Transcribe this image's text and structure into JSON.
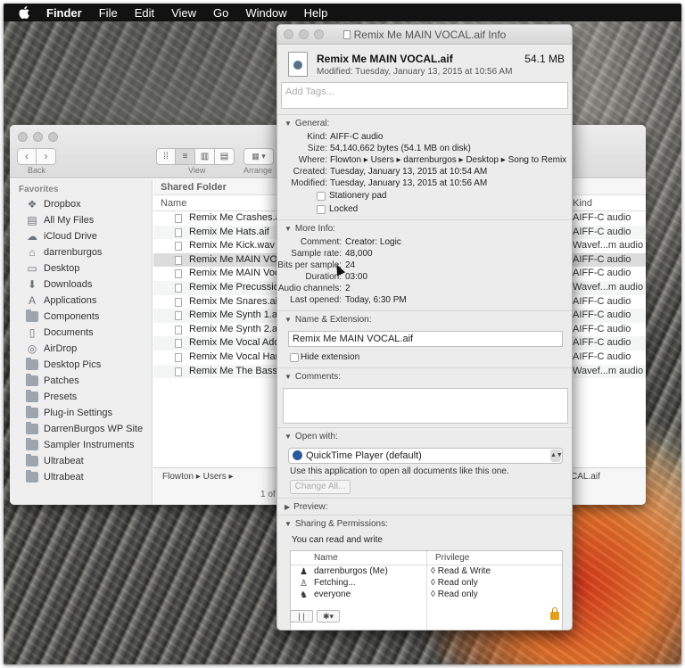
{
  "menubar": {
    "items": [
      "Finder",
      "File",
      "Edit",
      "View",
      "Go",
      "Window",
      "Help"
    ]
  },
  "finder": {
    "toolbar": {
      "back_label": "Back",
      "view_label": "View",
      "arrange_label": "Arrange"
    },
    "sidebar": {
      "header": "Favorites",
      "items": [
        {
          "label": "Dropbox",
          "icon": "dropbox-icon"
        },
        {
          "label": "All My Files",
          "icon": "all-files-icon"
        },
        {
          "label": "iCloud Drive",
          "icon": "cloud-icon"
        },
        {
          "label": "darrenburgos",
          "icon": "home-icon"
        },
        {
          "label": "Desktop",
          "icon": "desktop-icon"
        },
        {
          "label": "Downloads",
          "icon": "downloads-icon"
        },
        {
          "label": "Applications",
          "icon": "applications-icon"
        },
        {
          "label": "Components",
          "icon": "folder-icon"
        },
        {
          "label": "Documents",
          "icon": "documents-icon"
        },
        {
          "label": "AirDrop",
          "icon": "airdrop-icon"
        },
        {
          "label": "Desktop Pics",
          "icon": "folder-icon"
        },
        {
          "label": "Patches",
          "icon": "folder-icon"
        },
        {
          "label": "Presets",
          "icon": "folder-icon"
        },
        {
          "label": "Plug-in Settings",
          "icon": "folder-icon"
        },
        {
          "label": "DarrenBurgos WP Site",
          "icon": "folder-icon"
        },
        {
          "label": "Sampler Instruments",
          "icon": "folder-icon"
        },
        {
          "label": "Ultrabeat",
          "icon": "folder-icon"
        },
        {
          "label": "Ultrabeat",
          "icon": "folder-icon"
        }
      ]
    },
    "list": {
      "shared_header": "Shared Folder",
      "col_name": "Name",
      "col_kind": "Kind",
      "rows": [
        {
          "name": "Remix Me Crashes.aif",
          "kind": "AIFF-C audio"
        },
        {
          "name": "Remix Me Hats.aif",
          "kind": "AIFF-C audio"
        },
        {
          "name": "Remix Me Kick.wav",
          "kind": "Wavef...m audio"
        },
        {
          "name": "Remix Me MAIN VOCA",
          "kind": "AIFF-C audio"
        },
        {
          "name": "Remix Me MAIN Vocal",
          "kind": "AIFF-C audio"
        },
        {
          "name": "Remix Me Precussion",
          "kind": "Wavef...m audio"
        },
        {
          "name": "Remix Me Snares.aif",
          "kind": "AIFF-C audio"
        },
        {
          "name": "Remix Me Synth 1.aif",
          "kind": "AIFF-C audio"
        },
        {
          "name": "Remix Me Synth 2.aif",
          "kind": "AIFF-C audio"
        },
        {
          "name": "Remix Me Vocal Add L",
          "kind": "AIFF-C audio"
        },
        {
          "name": "Remix Me Vocal Harm",
          "kind": "AIFF-C audio"
        },
        {
          "name": "Remix Me The Bass",
          "kind": "Wavef...m audio"
        }
      ]
    },
    "pathbar": {
      "left": "Flowton ▸ Users ▸",
      "right": "CAL.aif"
    },
    "status": "1 of"
  },
  "info": {
    "title": "Remix Me MAIN VOCAL.aif Info",
    "filename": "Remix Me MAIN VOCAL.aif",
    "size": "54.1 MB",
    "modified": "Modified: Tuesday, January 13, 2015 at 10:56 AM",
    "tags_placeholder": "Add Tags...",
    "general": {
      "title": "General:",
      "kind_k": "Kind:",
      "kind_v": "AIFF-C audio",
      "size_k": "Size:",
      "size_v": "54,140,662 bytes (54.1 MB on disk)",
      "where_k": "Where:",
      "where_v": "Flowton ▸ Users ▸ darrenburgos ▸ Desktop ▸ Song to Remix",
      "created_k": "Created:",
      "created_v": "Tuesday, January 13, 2015 at 10:54 AM",
      "modified_k": "Modified:",
      "modified_v": "Tuesday, January 13, 2015 at 10:56 AM",
      "stationery": "Stationery pad",
      "locked": "Locked"
    },
    "more": {
      "title": "More Info:",
      "comment_k": "Comment:",
      "comment_v": "Creator: Logic",
      "rate_k": "Sample rate:",
      "rate_v": "48,000",
      "bits_k": "Bits per sample:",
      "bits_v": "24",
      "dur_k": "Duration:",
      "dur_v": "03:00",
      "chan_k": "Audio channels:",
      "chan_v": "2",
      "opened_k": "Last opened:",
      "opened_v": "Today, 6:30 PM"
    },
    "name_ext": {
      "title": "Name & Extension:",
      "value": "Remix Me MAIN VOCAL.aif",
      "hide": "Hide extension"
    },
    "comments_title": "Comments:",
    "open_with": {
      "title": "Open with:",
      "app": "QuickTime Player (default)",
      "hint": "Use this application to open all documents like this one.",
      "change_all": "Change All..."
    },
    "preview_title": "Preview:",
    "sharing": {
      "title": "Sharing & Permissions:",
      "hint": "You can read and write",
      "col_name": "Name",
      "col_priv": "Privilege",
      "rows": [
        {
          "name": "darrenburgos (Me)",
          "priv": "◊ Read & Write",
          "icon": "user-icon"
        },
        {
          "name": "Fetching...",
          "priv": "◊ Read only",
          "icon": "group-icon"
        },
        {
          "name": "everyone",
          "priv": "◊ Read only",
          "icon": "everyone-icon"
        }
      ]
    }
  },
  "colors": {
    "menubar": "#121212",
    "selection": "#dcdcdc",
    "lock": "#e0a020"
  }
}
